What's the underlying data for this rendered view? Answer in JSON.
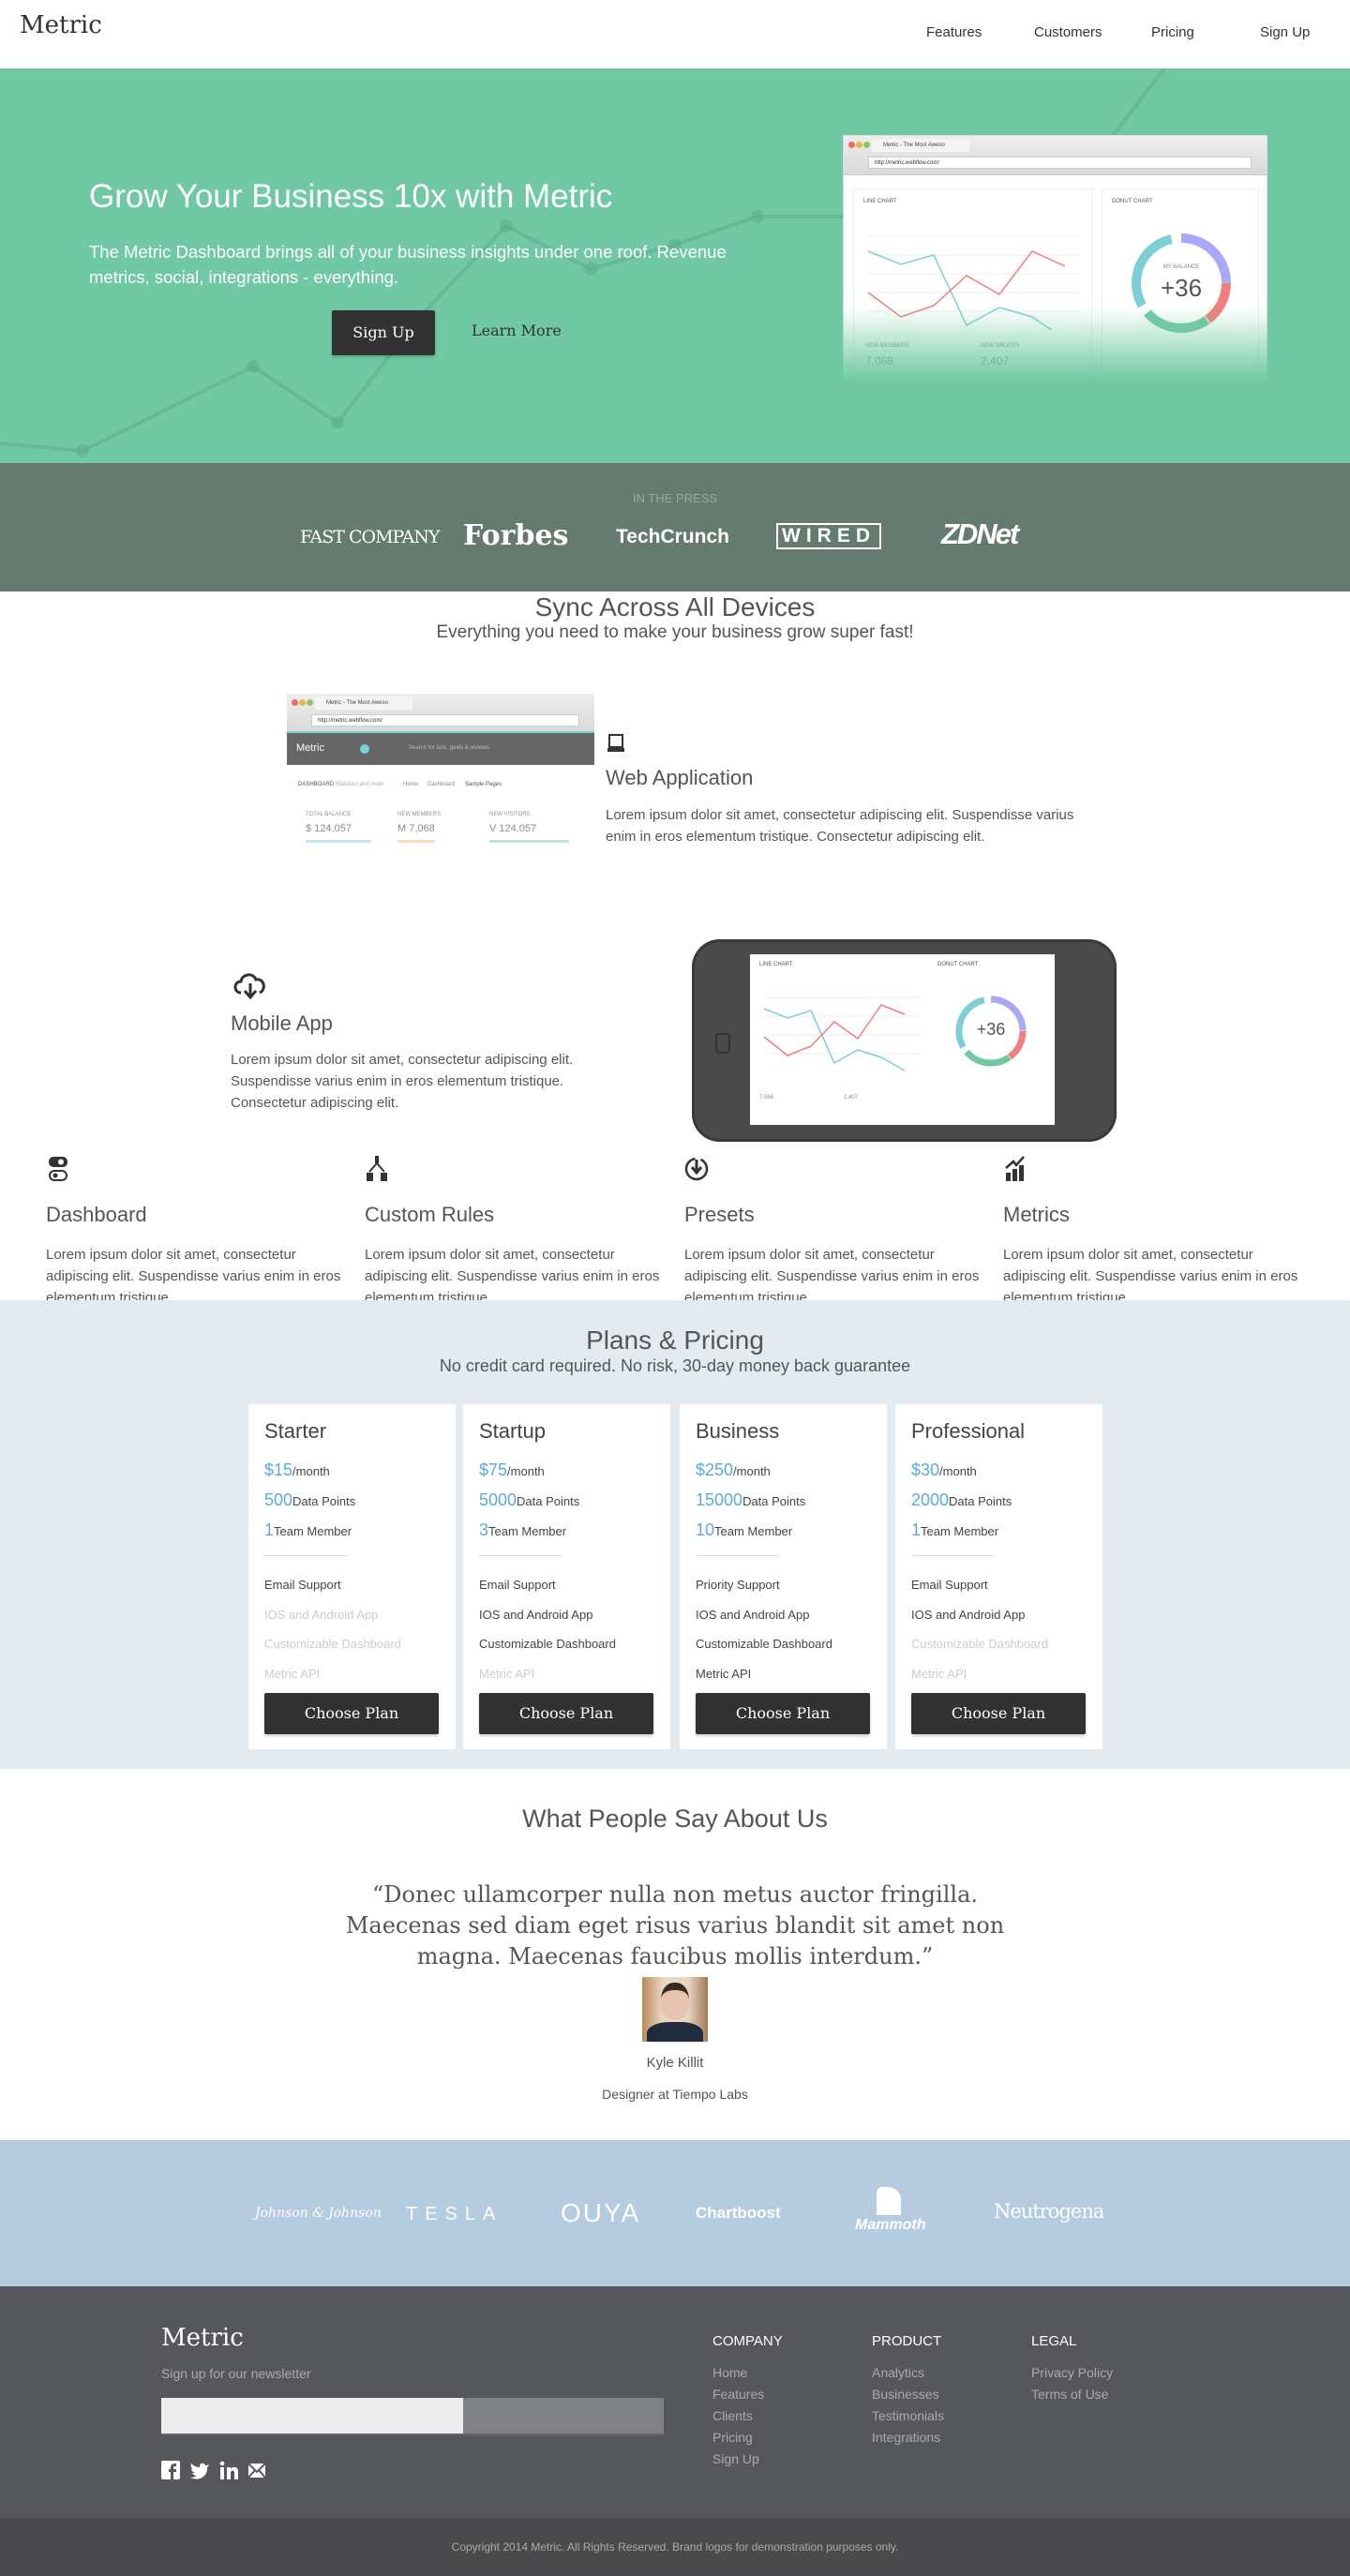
{
  "nav": {
    "logo": "Metric",
    "links": [
      "Features",
      "Customers",
      "Pricing",
      "Sign Up"
    ]
  },
  "hero": {
    "title": "Grow Your Business 10x with Metric",
    "text": "The Metric Dashboard brings all of your business insights under one roof. Revenue metrics, social, integrations - everything.",
    "signup": "Sign Up",
    "learn_more": "Learn More",
    "mock": {
      "tab": "Metric - The Most Aweso",
      "url": "http://metric.webflow.com/",
      "line_chart": "LINE CHART",
      "donut_chart": "DONUT CHART",
      "balance_label": "MY BALANCE",
      "balance": "+36",
      "new_members": "NEW MEMBERS",
      "members_value": "7,068",
      "new_orders": "NEW ORDERS",
      "orders_value": "2,407"
    }
  },
  "press": {
    "label": "IN THE PRESS",
    "logos": [
      "FAST COMPANY",
      "Forbes",
      "TechCrunch",
      "WIRED",
      "ZDNet"
    ]
  },
  "sync": {
    "title": "Sync Across All Devices",
    "subtitle": "Everything you need to make your business grow super fast!",
    "web": {
      "title": "Web Application",
      "text": "Lorem ipsum dolor sit amet, consectetur adipiscing elit. Suspendisse varius enim in eros elementum tristique. Consectetur adipiscing elit.",
      "mock": {
        "brand": "Metric",
        "search": "Search for task, goals & reviews",
        "crumb": "DASHBOARD",
        "crumb_sub": "Statistics and more",
        "links": [
          "Home",
          "Dashboard",
          "Sample Pages"
        ],
        "stats": [
          {
            "label": "TOTAL BALANCE",
            "value": "$ 124,057"
          },
          {
            "label": "NEW MEMBERS",
            "value": "M 7,068"
          },
          {
            "label": "NEW VISITORS",
            "value": "V 124,057"
          }
        ]
      }
    },
    "mobile": {
      "title": "Mobile App",
      "text": "Lorem ipsum dolor sit amet, consectetur adipiscing elit. Suspendisse varius enim in eros elementum tristique. Consectetur adipiscing elit."
    }
  },
  "features": [
    {
      "icon": "toggle-icon",
      "title": "Dashboard",
      "text": "Lorem ipsum dolor sit amet, consectetur adipiscing elit. Suspendisse varius enim in eros elementum tristique."
    },
    {
      "icon": "sitemap-icon",
      "title": "Custom Rules",
      "text": "Lorem ipsum dolor sit amet, consectetur adipiscing elit. Suspendisse varius enim in eros elementum tristique."
    },
    {
      "icon": "timer-icon",
      "title": "Presets",
      "text": "Lorem ipsum dolor sit amet, consectetur adipiscing elit. Suspendisse varius enim in eros elementum tristique."
    },
    {
      "icon": "chart-icon",
      "title": "Metrics",
      "text": "Lorem ipsum dolor sit amet, consectetur adipiscing elit. Suspendisse varius enim in eros elementum tristique."
    }
  ],
  "pricing": {
    "title": "Plans & Pricing",
    "subtitle": "No credit card required. No risk, 30-day money back guarantee",
    "per_month": "/month",
    "data_points": "Data Points",
    "team_member": "Team Member",
    "button": "Choose Plan",
    "accent": "#5aaae0",
    "plans": [
      {
        "name": "Starter",
        "price": "$15",
        "points": "500",
        "members": "1",
        "features": [
          {
            "t": "Email Support",
            "on": true
          },
          {
            "t": "IOS and Android App",
            "on": false
          },
          {
            "t": "Customizable Dashboard",
            "on": false
          },
          {
            "t": "Metric API",
            "on": false
          }
        ]
      },
      {
        "name": "Startup",
        "price": "$75",
        "points": "5000",
        "members": "3",
        "features": [
          {
            "t": "Email Support",
            "on": true
          },
          {
            "t": "IOS and Android App",
            "on": true
          },
          {
            "t": "Customizable Dashboard",
            "on": true
          },
          {
            "t": "Metric API",
            "on": false
          }
        ]
      },
      {
        "name": "Business",
        "price": "$250",
        "points": "15000",
        "members": "10",
        "features": [
          {
            "t": "Priority Support",
            "on": true
          },
          {
            "t": "IOS and Android App",
            "on": true
          },
          {
            "t": "Customizable Dashboard",
            "on": true
          },
          {
            "t": "Metric API",
            "on": true
          }
        ]
      },
      {
        "name": "Professional",
        "price": "$30",
        "points": "2000",
        "members": "1",
        "features": [
          {
            "t": "Email Support",
            "on": true
          },
          {
            "t": "IOS and Android App",
            "on": true
          },
          {
            "t": "Customizable Dashboard",
            "on": false
          },
          {
            "t": "Metric API",
            "on": false
          }
        ]
      }
    ]
  },
  "testimonial": {
    "title": "What People Say About Us",
    "quote": "“Donec ullamcorper nulla non metus auctor fringilla. Maecenas sed diam eget risus varius blandit sit amet non magna. Maecenas faucibus mollis interdum.”",
    "name": "Kyle Killit",
    "role": "Designer at Tiempo Labs"
  },
  "clients": [
    "Johnson & Johnson",
    "TESLA",
    "OUYA",
    "Chartboost",
    "Mammoth",
    "Neutrogena"
  ],
  "footer": {
    "logo": "Metric",
    "newsletter": "Sign up for our newsletter",
    "email_value": "",
    "columns": [
      {
        "title": "COMPANY",
        "links": [
          "Home",
          "Features",
          "Clients",
          "Pricing",
          "Sign Up"
        ]
      },
      {
        "title": "PRODUCT",
        "links": [
          "Analytics",
          "Businesses",
          "Testimonials",
          "Integrations"
        ]
      },
      {
        "title": "LEGAL",
        "links": [
          "Privacy Policy",
          "Terms of Use"
        ]
      }
    ],
    "social": [
      "facebook-icon",
      "twitter-icon",
      "linkedin-icon",
      "email-icon"
    ],
    "copyright": "Copyright 2014 Metric. All Rights Reserved. Brand logos for demonstration purposes only."
  }
}
